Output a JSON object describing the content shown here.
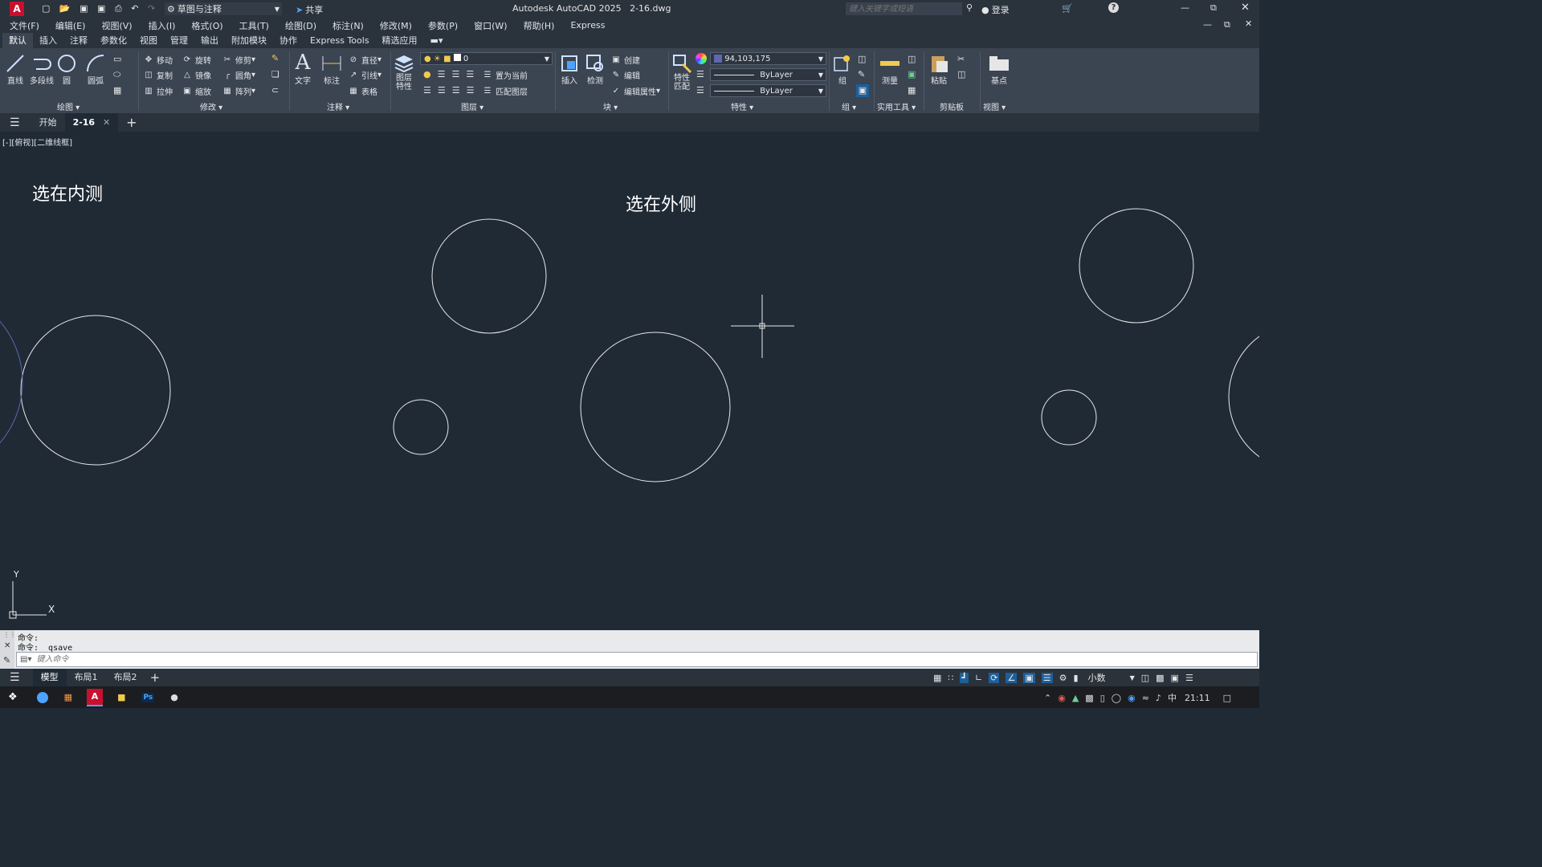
{
  "titlebar": {
    "workspace": "草图与注释",
    "share": "共享",
    "app_title": "Autodesk AutoCAD 2025",
    "file_name": "2-16.dwg",
    "search_placeholder": "键入关键字或短语",
    "login": "登录"
  },
  "menubar": [
    "文件(F)",
    "编辑(E)",
    "视图(V)",
    "插入(I)",
    "格式(O)",
    "工具(T)",
    "绘图(D)",
    "标注(N)",
    "修改(M)",
    "参数(P)",
    "窗口(W)",
    "帮助(H)",
    "Express"
  ],
  "ribbon_tabs": [
    "默认",
    "插入",
    "注释",
    "参数化",
    "视图",
    "管理",
    "输出",
    "附加模块",
    "协作",
    "Express Tools",
    "精选应用"
  ],
  "ribbon": {
    "draw": {
      "line": "直线",
      "polyline": "多段线",
      "circle": "圆",
      "arc": "圆弧",
      "panel": "绘图"
    },
    "modify": {
      "move": "移动",
      "rotate": "旋转",
      "trim": "修剪",
      "copy": "复制",
      "mirror": "镜像",
      "fillet": "圆角",
      "stretch": "拉伸",
      "scale": "缩放",
      "array": "阵列",
      "panel": "修改"
    },
    "annotation": {
      "text": "文字",
      "dimension": "标注",
      "diameter": "直径",
      "leader": "引线",
      "table": "表格",
      "panel": "注释"
    },
    "layers": {
      "layer_props": "图层特性",
      "layer_value": "0",
      "set_current": "置为当前",
      "match_layer": "匹配图层",
      "panel": "图层"
    },
    "block": {
      "insert": "插入",
      "detect": "检测",
      "create": "创建",
      "edit": "编辑",
      "edit_attr": "编辑属性",
      "panel": "块"
    },
    "properties": {
      "match": "特性匹配",
      "color": "94,103,175",
      "linetype": "ByLayer",
      "lineweight": "ByLayer",
      "panel": "特性"
    },
    "group": {
      "group": "组",
      "panel": "组"
    },
    "utilities": {
      "measure": "测量",
      "panel": "实用工具"
    },
    "clipboard": {
      "paste": "粘贴",
      "panel": "剪贴板"
    },
    "view": {
      "base": "基点",
      "panel": "视图"
    }
  },
  "doc_tabs": {
    "start": "开始",
    "current": "2-16"
  },
  "viewport_label": "[-][俯视][二维线框]",
  "canvas": {
    "label_inside": "选在内测",
    "label_outside": "选在外侧",
    "ucs_x": "X",
    "ucs_y": "Y"
  },
  "command": {
    "line1": "命令:",
    "line2": "命令: _qsave",
    "placeholder": "键入命令"
  },
  "status": {
    "tabs": [
      "模型",
      "布局1",
      "布局2"
    ],
    "units": "小数"
  },
  "taskbar": {
    "ime": "中",
    "time": "21:11"
  },
  "colors": {
    "canvas_bg": "#1f2a35",
    "ribbon_bg": "#3b4451",
    "layer_color": "#5e67af"
  }
}
